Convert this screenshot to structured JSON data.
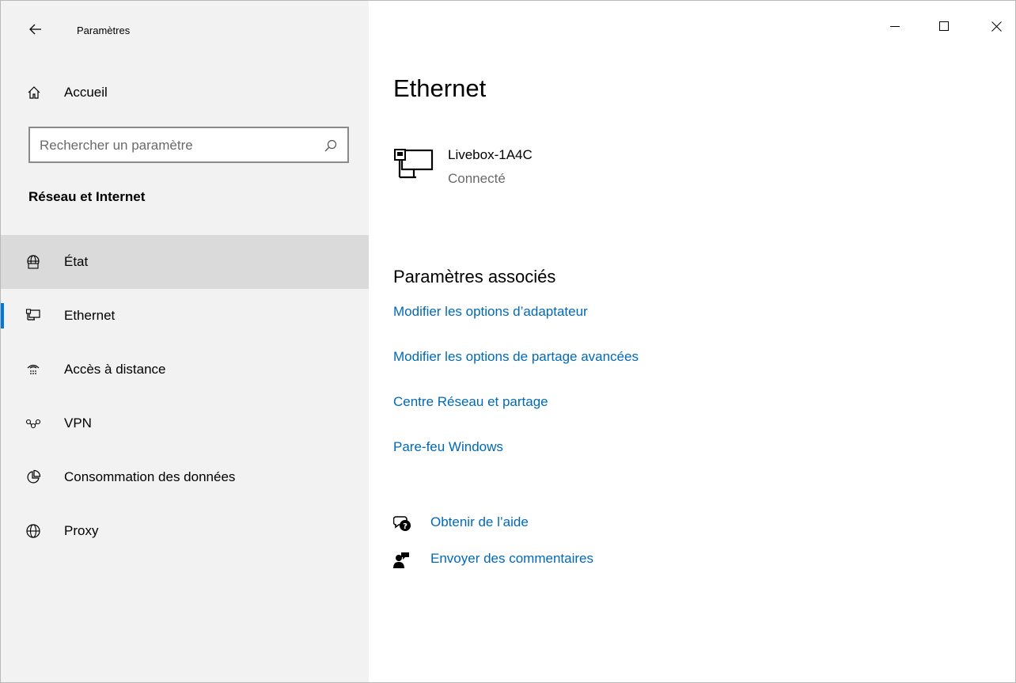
{
  "window": {
    "title": "Paramètres"
  },
  "sidebar": {
    "home_label": "Accueil",
    "search_placeholder": "Rechercher un paramètre",
    "section_title": "Réseau et Internet",
    "items": [
      {
        "label": "État",
        "icon": "status-globe-icon"
      },
      {
        "label": "Ethernet",
        "icon": "ethernet-icon",
        "selected": true
      },
      {
        "label": "Accès à distance",
        "icon": "dial-up-icon"
      },
      {
        "label": "VPN",
        "icon": "vpn-icon"
      },
      {
        "label": "Consommation des données",
        "icon": "data-usage-icon"
      },
      {
        "label": "Proxy",
        "icon": "globe-icon"
      }
    ]
  },
  "main": {
    "title": "Ethernet",
    "connection": {
      "name": "Livebox-1A4C",
      "status": "Connecté"
    },
    "related": {
      "title": "Paramètres associés",
      "links": [
        "Modifier les options d’adaptateur",
        "Modifier les options de partage avancées",
        "Centre Réseau et partage",
        "Pare-feu Windows"
      ]
    },
    "help": {
      "get_help": "Obtenir de l’aide",
      "feedback": "Envoyer des commentaires"
    }
  },
  "colors": {
    "sidebar_bg": "#f2f2f2",
    "hover_bg": "#dadada",
    "accent": "#0078d7",
    "link": "#0069b7"
  }
}
